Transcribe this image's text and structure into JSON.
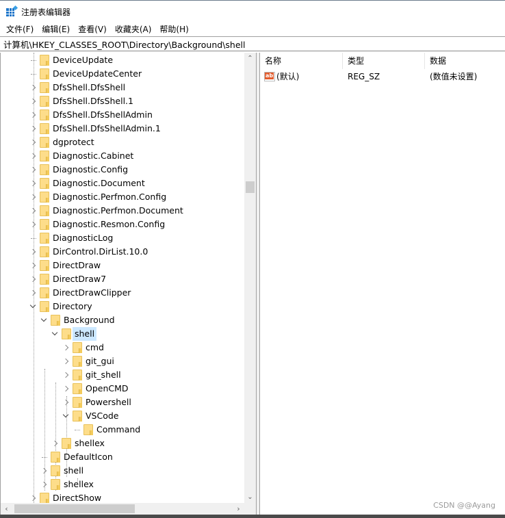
{
  "window": {
    "title": "注册表编辑器",
    "app_icon": "registry-editor-icon"
  },
  "menubar": {
    "items": [
      {
        "label": "文件(F)"
      },
      {
        "label": "编辑(E)"
      },
      {
        "label": "查看(V)"
      },
      {
        "label": "收藏夹(A)"
      },
      {
        "label": "帮助(H)"
      }
    ]
  },
  "address": {
    "path": "计算机\\HKEY_CLASSES_ROOT\\Directory\\Background\\shell"
  },
  "tree": {
    "rows": [
      {
        "label": "DeviceUpdate",
        "depth": 0,
        "state": "leaf"
      },
      {
        "label": "DeviceUpdateCenter",
        "depth": 0,
        "state": "leaf"
      },
      {
        "label": "DfsShell.DfsShell",
        "depth": 0,
        "state": "collapsed"
      },
      {
        "label": "DfsShell.DfsShell.1",
        "depth": 0,
        "state": "collapsed"
      },
      {
        "label": "DfsShell.DfsShellAdmin",
        "depth": 0,
        "state": "collapsed"
      },
      {
        "label": "DfsShell.DfsShellAdmin.1",
        "depth": 0,
        "state": "collapsed"
      },
      {
        "label": "dgprotect",
        "depth": 0,
        "state": "collapsed"
      },
      {
        "label": "Diagnostic.Cabinet",
        "depth": 0,
        "state": "collapsed"
      },
      {
        "label": "Diagnostic.Config",
        "depth": 0,
        "state": "collapsed"
      },
      {
        "label": "Diagnostic.Document",
        "depth": 0,
        "state": "collapsed"
      },
      {
        "label": "Diagnostic.Perfmon.Config",
        "depth": 0,
        "state": "collapsed"
      },
      {
        "label": "Diagnostic.Perfmon.Document",
        "depth": 0,
        "state": "collapsed"
      },
      {
        "label": "Diagnostic.Resmon.Config",
        "depth": 0,
        "state": "collapsed"
      },
      {
        "label": "DiagnosticLog",
        "depth": 0,
        "state": "leaf"
      },
      {
        "label": "DirControl.DirList.10.0",
        "depth": 0,
        "state": "collapsed"
      },
      {
        "label": "DirectDraw",
        "depth": 0,
        "state": "collapsed"
      },
      {
        "label": "DirectDraw7",
        "depth": 0,
        "state": "collapsed"
      },
      {
        "label": "DirectDrawClipper",
        "depth": 0,
        "state": "collapsed"
      },
      {
        "label": "Directory",
        "depth": 0,
        "state": "expanded"
      },
      {
        "label": "Background",
        "depth": 1,
        "state": "expanded"
      },
      {
        "label": "shell",
        "depth": 2,
        "state": "expanded",
        "selected": true
      },
      {
        "label": "cmd",
        "depth": 3,
        "state": "collapsed"
      },
      {
        "label": "git_gui",
        "depth": 3,
        "state": "collapsed"
      },
      {
        "label": "git_shell",
        "depth": 3,
        "state": "collapsed"
      },
      {
        "label": "OpenCMD",
        "depth": 3,
        "state": "collapsed"
      },
      {
        "label": "Powershell",
        "depth": 3,
        "state": "collapsed"
      },
      {
        "label": "VSCode",
        "depth": 3,
        "state": "expanded"
      },
      {
        "label": "Command",
        "depth": 4,
        "state": "leaf"
      },
      {
        "label": "shellex",
        "depth": 2,
        "state": "collapsed"
      },
      {
        "label": "DefaultIcon",
        "depth": 1,
        "state": "leaf"
      },
      {
        "label": "shell",
        "depth": 1,
        "state": "collapsed"
      },
      {
        "label": "shellex",
        "depth": 1,
        "state": "collapsed"
      },
      {
        "label": "DirectShow",
        "depth": 0,
        "state": "collapsed"
      }
    ]
  },
  "list": {
    "columns": {
      "name": "名称",
      "type": "类型",
      "data": "数据"
    },
    "rows": [
      {
        "name": "(默认)",
        "type": "REG_SZ",
        "data": "(数值未设置)",
        "icon": "string-value-icon",
        "icon_text": "ab"
      }
    ]
  },
  "scrollbars": {
    "up": "⌃",
    "down": "⌄",
    "left": "‹",
    "right": "›"
  },
  "watermark": "CSDN @@Ayang"
}
